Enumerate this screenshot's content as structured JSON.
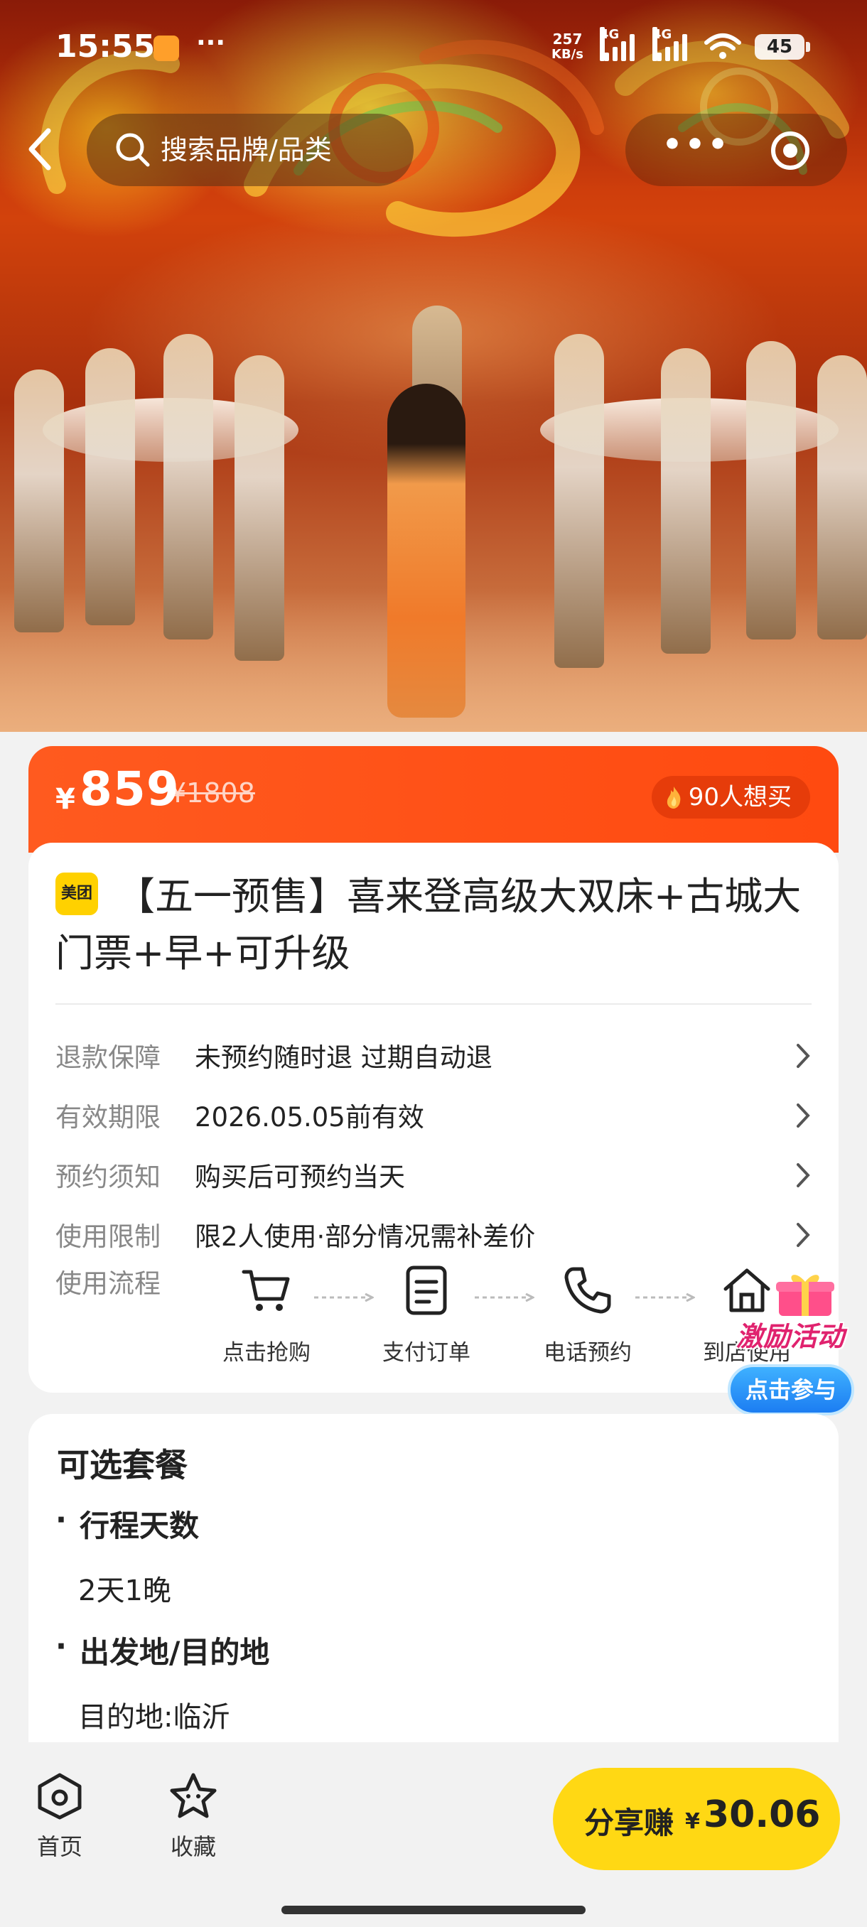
{
  "status_bar": {
    "time": "15:55",
    "dots": "···",
    "net_speed_top": "257",
    "net_speed_unit": "KB/s",
    "signal_1_label": "4G",
    "signal_2_label": "4G",
    "battery": "45"
  },
  "nav": {
    "search_placeholder": "搜索品牌/品类",
    "more_label": "•••",
    "icons": [
      "back-arrow-icon",
      "search-icon",
      "more-icon",
      "target-icon"
    ]
  },
  "price": {
    "currency": "¥",
    "current": "859",
    "original": "¥1808",
    "want_count": "90人想买",
    "accent_color": "#ff4a10"
  },
  "product": {
    "brand_badge": "美团",
    "title": "【五一预售】喜来登高级大双床+古城大门票+早+可升级"
  },
  "details": [
    {
      "key": "退款保障",
      "value": "未预约随时退 过期自动退"
    },
    {
      "key": "有效期限",
      "value": "2026.05.05前有效"
    },
    {
      "key": "预约须知",
      "value": "购买后可预约当天"
    },
    {
      "key": "使用限制",
      "value": "限2人使用·部分情况需补差价"
    }
  ],
  "flow": {
    "label": "使用流程",
    "steps": [
      {
        "label": "点击抢购",
        "icon": "cart-icon"
      },
      {
        "label": "支付订单",
        "icon": "document-icon"
      },
      {
        "label": "电话预约",
        "icon": "phone-icon"
      },
      {
        "label": "到店使用",
        "icon": "store-icon"
      }
    ]
  },
  "promo": {
    "title": "激励活动",
    "cta": "点击参与"
  },
  "package": {
    "heading": "可选套餐",
    "sections": [
      {
        "name": "行程天数",
        "value": "2天1晚"
      },
      {
        "name": "出发地/目的地",
        "value": "目的地:临沂"
      }
    ]
  },
  "bottom": {
    "tabs": [
      {
        "label": "首页",
        "icon": "home-icon"
      },
      {
        "label": "收藏",
        "icon": "star-icon"
      }
    ],
    "share_label": "分享赚",
    "share_currency": "¥",
    "share_amount": "30.06",
    "share_color": "#ffd814"
  }
}
